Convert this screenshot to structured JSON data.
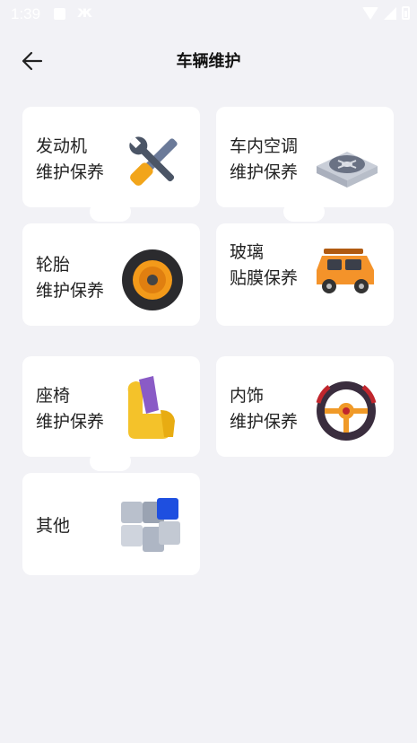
{
  "status_bar": {
    "time": "1:39"
  },
  "header": {
    "title": "车辆维护",
    "back_icon": "arrow-left-icon"
  },
  "cards": [
    {
      "line1": "发动机",
      "line2": "维护保养",
      "icon": "tools-icon"
    },
    {
      "line1": "车内空调",
      "line2": "维护保养",
      "icon": "air-conditioner-fan-icon"
    },
    {
      "line1": "轮胎",
      "line2": "维护保养",
      "icon": "tire-icon"
    },
    {
      "line1": "玻璃",
      "line2": "贴膜保养",
      "icon": "car-icon"
    },
    {
      "line1": "座椅",
      "line2": "维护保养",
      "icon": "seat-icon"
    },
    {
      "line1": "内饰",
      "line2": "维护保养",
      "icon": "steering-wheel-icon"
    },
    {
      "line1": "其他",
      "line2": "",
      "icon": "blocks-icon"
    }
  ],
  "colors": {
    "background": "#f2f2f6",
    "card": "#ffffff",
    "text": "#222222"
  }
}
